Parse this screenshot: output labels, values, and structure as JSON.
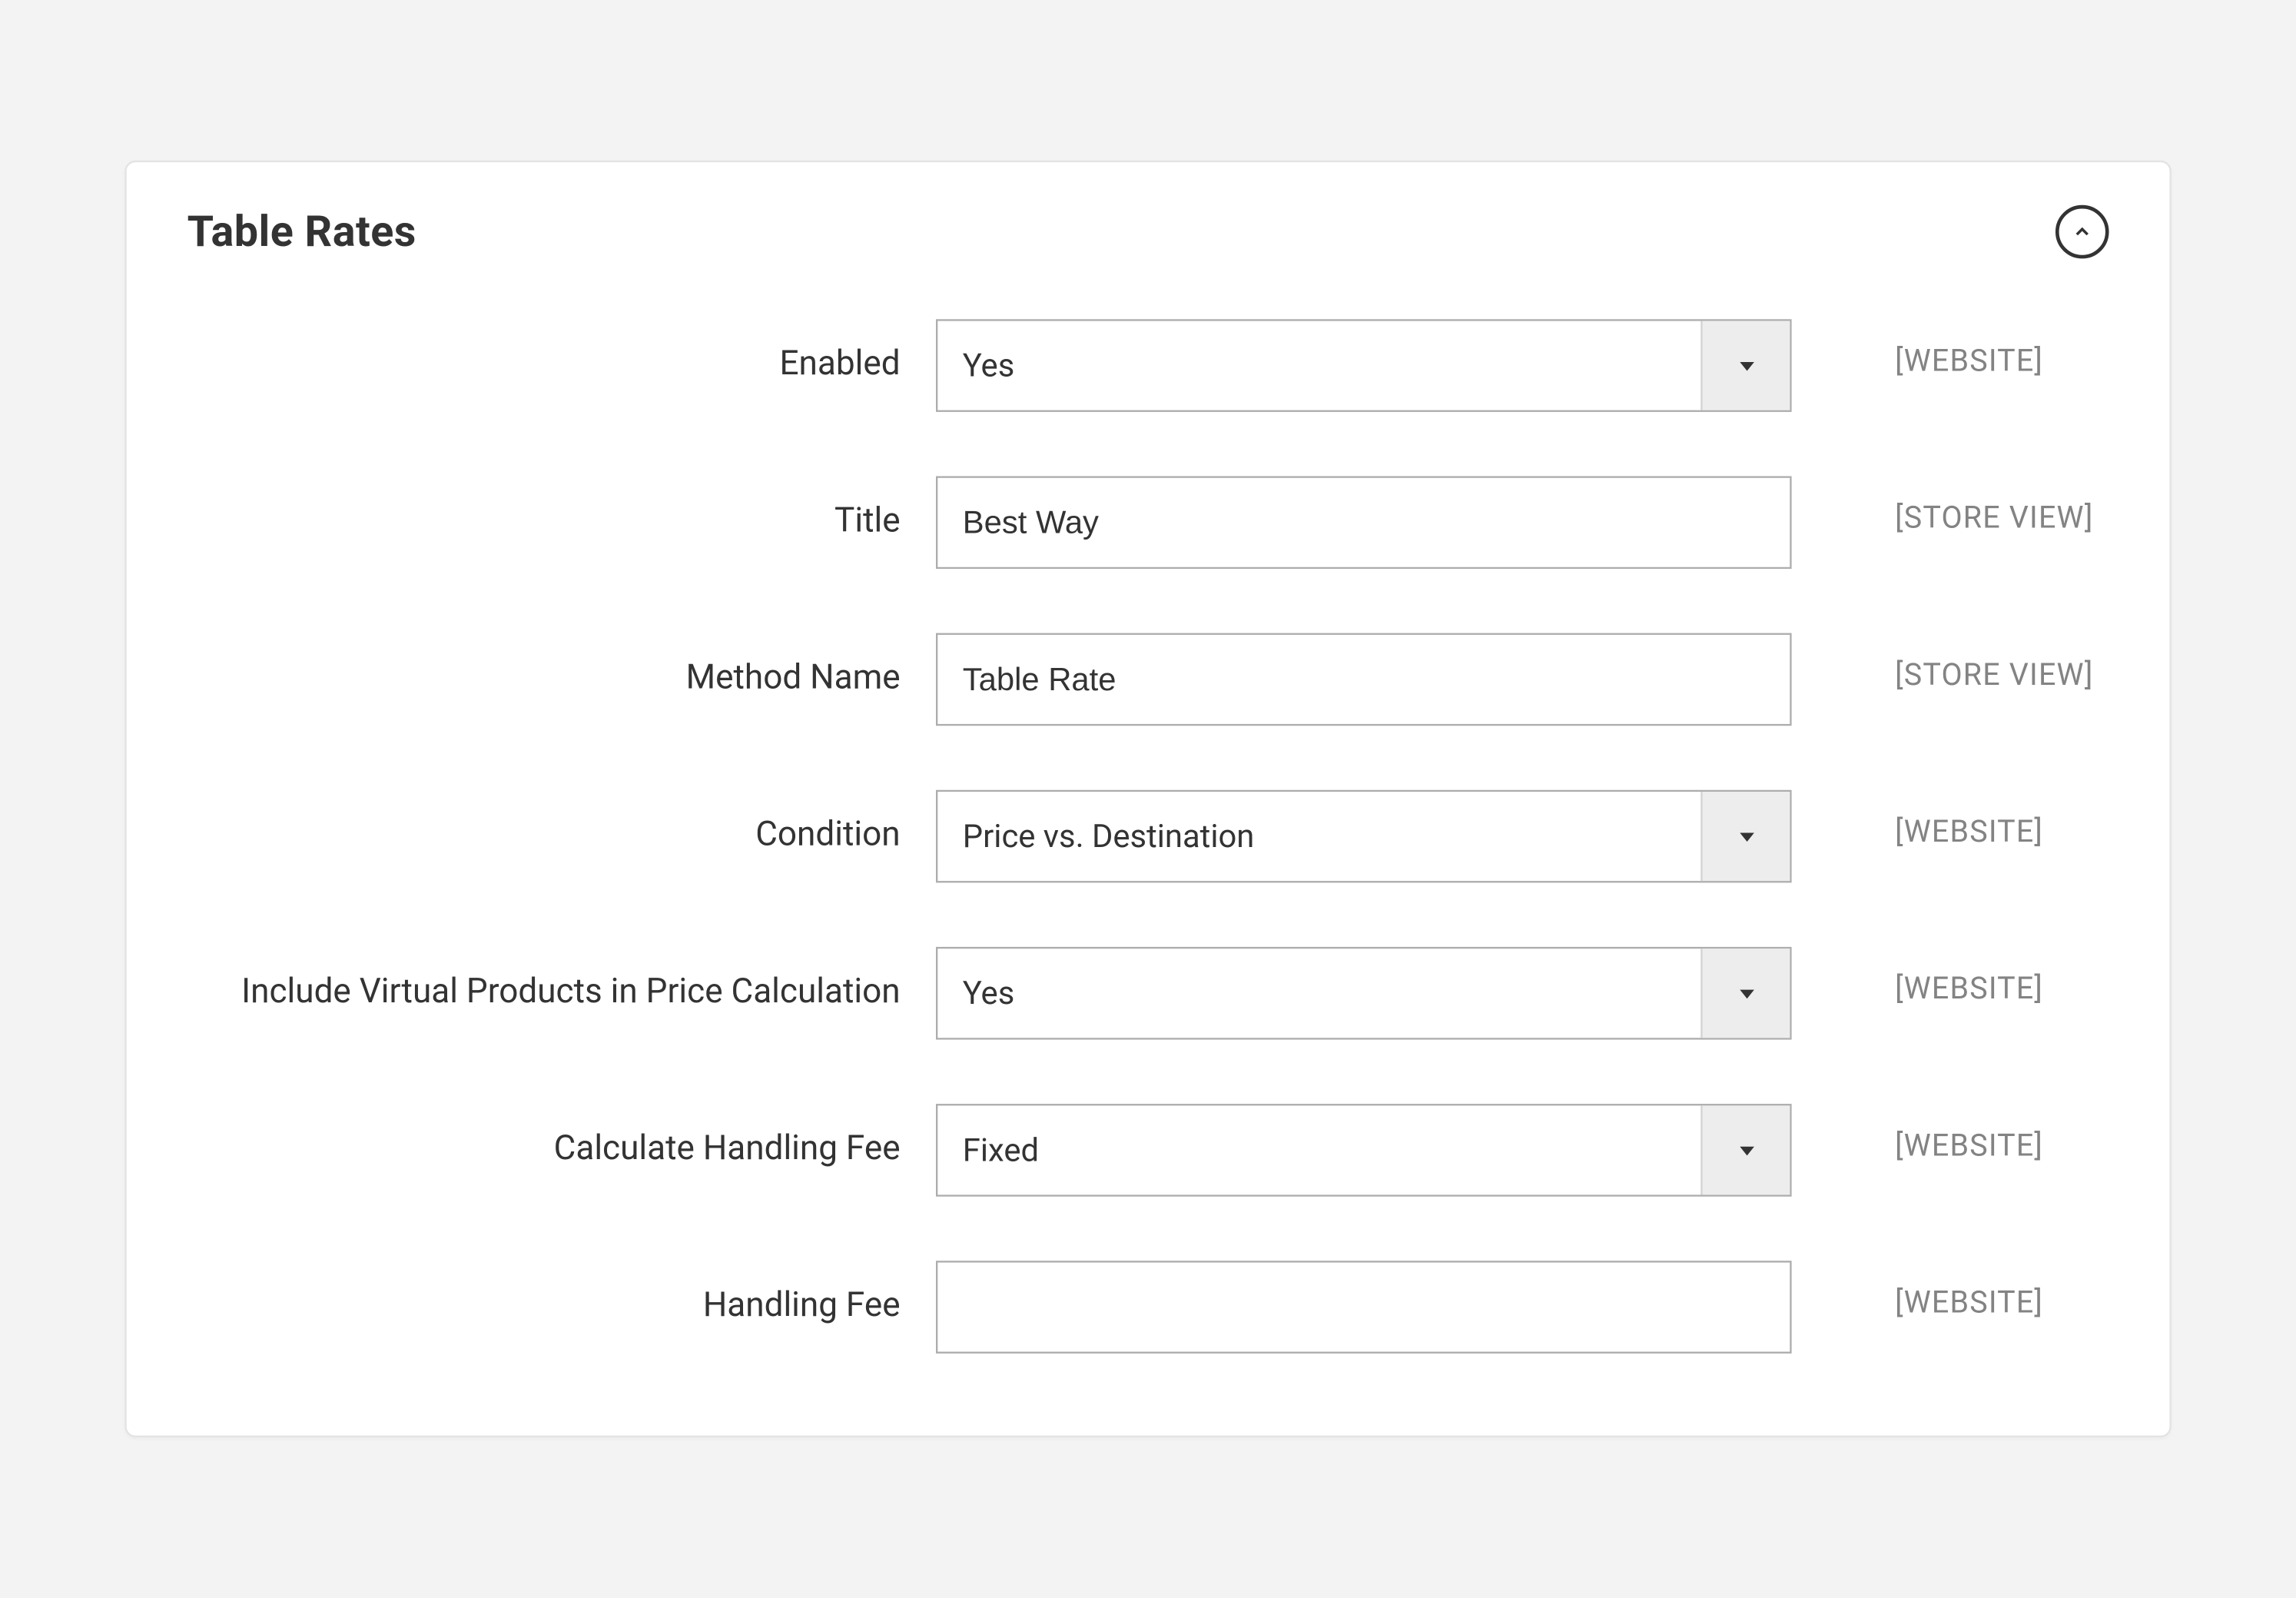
{
  "panel": {
    "title": "Table Rates"
  },
  "scopes": {
    "website": "[WEBSITE]",
    "store_view": "[STORE VIEW]"
  },
  "fields": {
    "enabled": {
      "label": "Enabled",
      "value": "Yes"
    },
    "title": {
      "label": "Title",
      "value": "Best Way"
    },
    "method_name": {
      "label": "Method Name",
      "value": "Table Rate"
    },
    "condition": {
      "label": "Condition",
      "value": "Price vs. Destination"
    },
    "include_virtual": {
      "label": "Include Virtual Products in Price Calculation",
      "value": "Yes"
    },
    "calc_handling": {
      "label": "Calculate Handling Fee",
      "value": "Fixed"
    },
    "handling_fee": {
      "label": "Handling Fee",
      "value": ""
    }
  }
}
